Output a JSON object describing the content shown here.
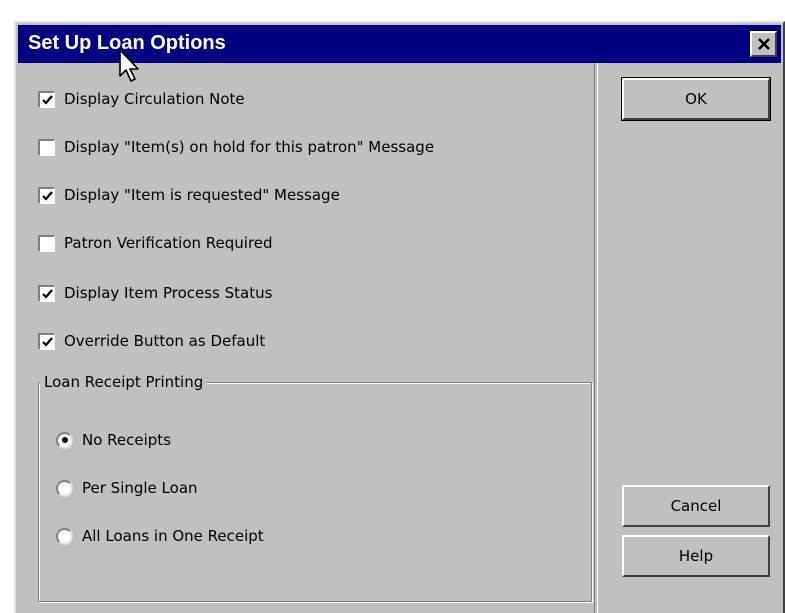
{
  "window": {
    "title": "Set Up Loan Options",
    "close_glyph": "✕"
  },
  "options": [
    {
      "label": "Display Circulation Note",
      "checked": true
    },
    {
      "label": "Display \"Item(s) on hold for this patron\" Message",
      "checked": false
    },
    {
      "label": "Display \"Item is requested\" Message",
      "checked": true
    },
    {
      "label": "Patron Verification Required",
      "checked": false
    },
    {
      "label": "Display Item Process Status",
      "checked": true
    },
    {
      "label": "Override Button as Default",
      "checked": true
    }
  ],
  "receipt_group": {
    "legend": "Loan Receipt Printing",
    "choices": [
      {
        "label": "No Receipts",
        "selected": true
      },
      {
        "label": "Per Single Loan",
        "selected": false
      },
      {
        "label": "All Loans in One Receipt",
        "selected": false
      }
    ]
  },
  "buttons": {
    "ok": "OK",
    "cancel": "Cancel",
    "help": "Help"
  },
  "colors": {
    "titlebar": "#000080",
    "face": "#c0c0c0"
  }
}
